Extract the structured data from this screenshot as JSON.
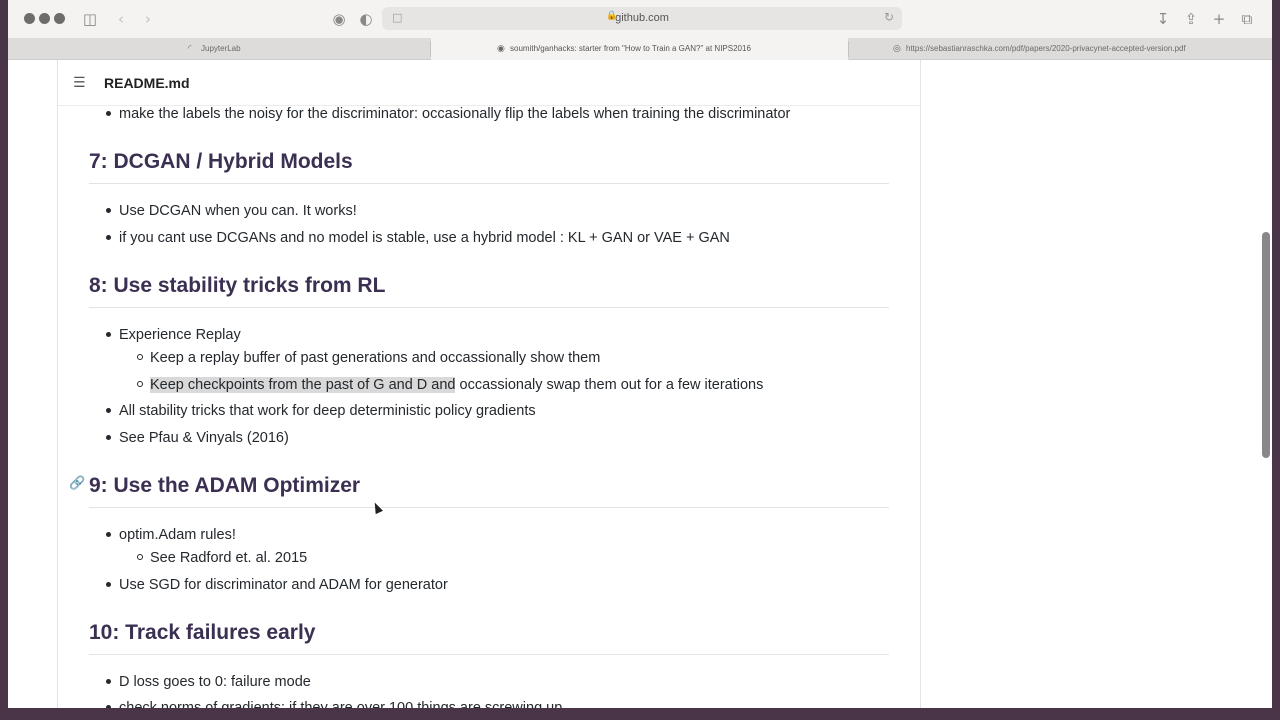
{
  "browser": {
    "url": "github.com",
    "tabs": [
      {
        "label": "JupyterLab",
        "active": false
      },
      {
        "label": "soumith/ganhacks: starter from \"How to Train a GAN?\" at NIPS2016",
        "active": true
      },
      {
        "label": "https://sebastianraschka.com/pdf/papers/2020-privacynet-accepted-version.pdf",
        "active": false
      }
    ]
  },
  "readme": {
    "title": "README.md",
    "top_item": "make the labels the noisy for the discriminator: occasionally flip the labels when training the discriminator",
    "sections": [
      {
        "heading": "7: DCGAN / Hybrid Models",
        "items": [
          "Use DCGAN when you can. It works!",
          "if you cant use DCGANs and no model is stable, use a hybrid model : KL + GAN or VAE + GAN"
        ]
      },
      {
        "heading": "8: Use stability tricks from RL",
        "items": [
          "Experience Replay",
          "All stability tricks that work for deep deterministic policy gradients",
          "See Pfau & Vinyals (2016)"
        ],
        "subitems": [
          "Keep a replay buffer of past generations and occassionally show them",
          "Keep checkpoints from the past of G and D and",
          " occassionaly swap them out for a few iterations"
        ]
      },
      {
        "heading": "9: Use the ADAM Optimizer",
        "items": [
          "optim.Adam rules!",
          "Use SGD for discriminator and ADAM for generator"
        ],
        "subitems": [
          "See Radford et. al. 2015"
        ]
      },
      {
        "heading": "10: Track failures early",
        "items": [
          "D loss goes to 0: failure mode",
          "check norms of gradients: if they are over 100 things are screwing up"
        ]
      }
    ]
  },
  "icons": {
    "sidebar": "sidebar-icon",
    "back": "chevron-left-icon",
    "forward": "chevron-right-icon",
    "shield": "shield-icon",
    "download": "download-icon",
    "share": "share-icon",
    "new_tab": "plus-icon",
    "tabs_overview": "tabs-icon",
    "toc": "list-icon",
    "anchor": "link-icon"
  }
}
